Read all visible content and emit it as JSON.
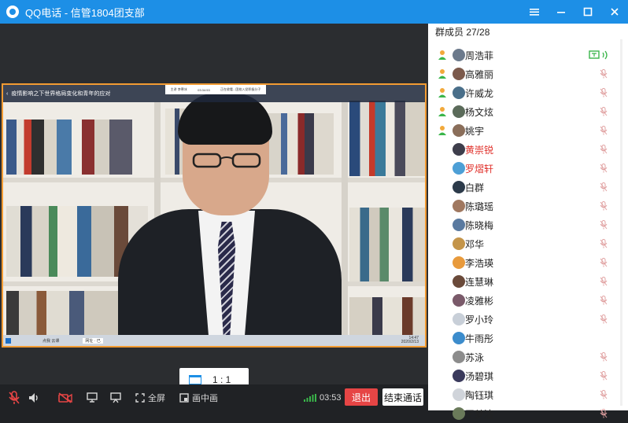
{
  "window": {
    "title": "QQ电话 - 信管1804团支部"
  },
  "video": {
    "slide_title": "疫情影响之下世界格局变化和青年的应对",
    "overlay_items": [
      "主讲 李寒冰",
      "03:34:53",
      "正在收看...团校入党积极分子"
    ],
    "taskbar_items": [
      "点我 云课",
      "网址 · 已"
    ],
    "taskbar_time": "14:47",
    "taskbar_date": "2020/2/13"
  },
  "ratio_label": "1 : 1",
  "toolbar": {
    "fullscreen": "全屏",
    "pip": "画中画",
    "timer": "03:53",
    "exit": "退出",
    "end_call": "结束通话"
  },
  "members": {
    "header": "群成员 27/28",
    "list": [
      {
        "name": "周浩菲",
        "host": true,
        "red": false,
        "mic": "active",
        "avatar": "#6c7a8c"
      },
      {
        "name": "高雅丽",
        "host": true,
        "red": false,
        "mic": "muted",
        "avatar": "#7c5a4c"
      },
      {
        "name": "许威龙",
        "host": true,
        "red": false,
        "mic": "muted",
        "avatar": "#4a6f8a"
      },
      {
        "name": "杨文炫",
        "host": true,
        "red": false,
        "mic": "muted",
        "avatar": "#5b6b5a"
      },
      {
        "name": "姚宇",
        "host": true,
        "red": false,
        "mic": "muted",
        "avatar": "#8a6e5a"
      },
      {
        "name": "黄崇锐",
        "host": false,
        "red": true,
        "mic": "muted",
        "avatar": "#3e3e4c"
      },
      {
        "name": "罗熠轩",
        "host": false,
        "red": true,
        "mic": "muted",
        "avatar": "#4d9fd6"
      },
      {
        "name": "白群",
        "host": false,
        "red": false,
        "mic": "muted",
        "avatar": "#2c3a4a"
      },
      {
        "name": "陈璐瑶",
        "host": false,
        "red": false,
        "mic": "muted",
        "avatar": "#a07860"
      },
      {
        "name": "陈晓梅",
        "host": false,
        "red": false,
        "mic": "muted",
        "avatar": "#5a7aa0"
      },
      {
        "name": "邓华",
        "host": false,
        "red": false,
        "mic": "muted",
        "avatar": "#c4954a"
      },
      {
        "name": "李浩瑛",
        "host": false,
        "red": false,
        "mic": "muted",
        "avatar": "#e89a3c"
      },
      {
        "name": "连慧琳",
        "host": false,
        "red": false,
        "mic": "muted",
        "avatar": "#6a4a3a"
      },
      {
        "name": "凌雅彬",
        "host": false,
        "red": false,
        "mic": "muted",
        "avatar": "#7a5a6a"
      },
      {
        "name": "罗小玲",
        "host": false,
        "red": false,
        "mic": "muted",
        "avatar": "#c8cfd8"
      },
      {
        "name": "牛雨彤",
        "host": false,
        "red": false,
        "mic": "none",
        "avatar": "#3c8ccc"
      },
      {
        "name": "苏泳",
        "host": false,
        "red": false,
        "mic": "muted",
        "avatar": "#8c8c8c"
      },
      {
        "name": "汤碧琪",
        "host": false,
        "red": false,
        "mic": "muted",
        "avatar": "#3a3a5c"
      },
      {
        "name": "陶钰琪",
        "host": false,
        "red": false,
        "mic": "muted",
        "avatar": "#d0d4da"
      },
      {
        "name": "王梦洁",
        "host": false,
        "red": false,
        "mic": "muted",
        "avatar": "#6a7a5a"
      }
    ]
  },
  "colors": {
    "accent": "#1d8fe6",
    "exit": "#e64545",
    "speaker_border": "#f29b32",
    "red_name": "#e0302a",
    "active_green": "#3ab54a"
  }
}
